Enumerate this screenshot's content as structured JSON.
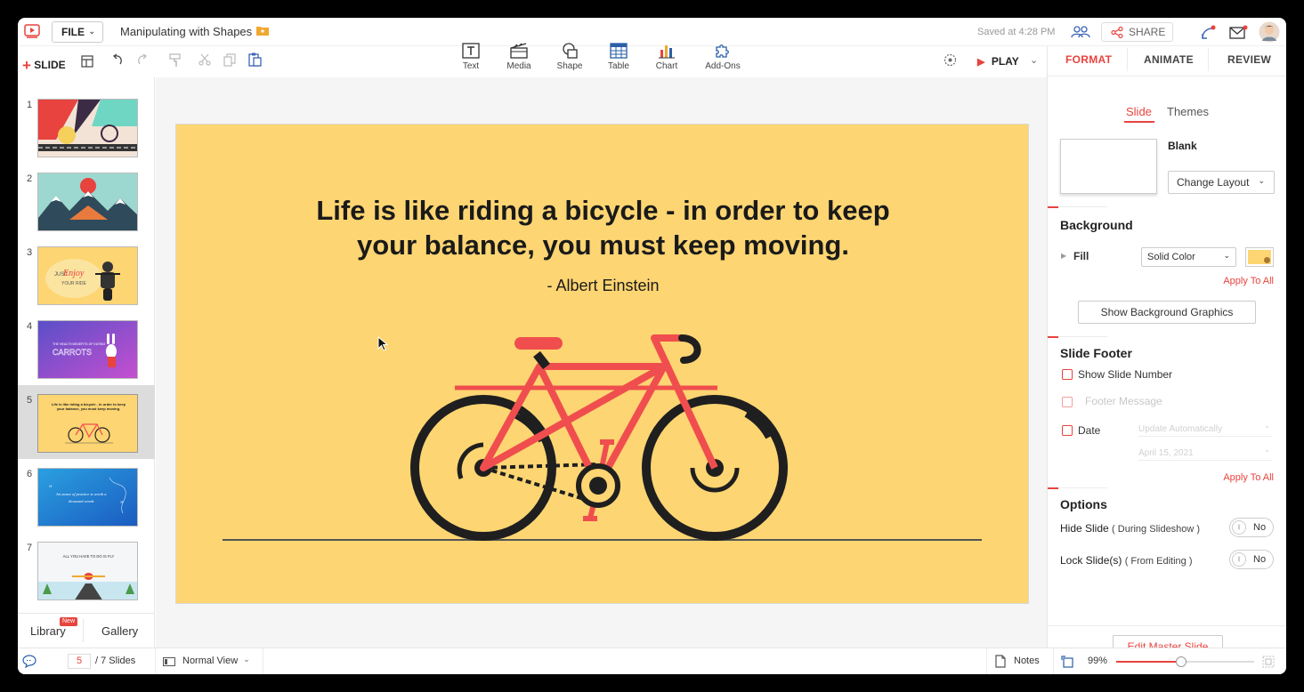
{
  "header": {
    "file_label": "FILE",
    "doc_title": "Manipulating with Shapes",
    "saved_status": "Saved at 4:28 PM",
    "share_label": "SHARE"
  },
  "toolbar": {
    "slide_label": "SLIDE",
    "insert_tools": [
      {
        "label": "Text",
        "icon": "text-box-icon"
      },
      {
        "label": "Media",
        "icon": "media-clapper-icon"
      },
      {
        "label": "Shape",
        "icon": "shape-icon"
      },
      {
        "label": "Table",
        "icon": "table-icon"
      },
      {
        "label": "Chart",
        "icon": "chart-icon"
      },
      {
        "label": "Add-Ons",
        "icon": "puzzle-icon"
      }
    ],
    "play_label": "PLAY"
  },
  "right_tabs": [
    "FORMAT",
    "ANIMATE",
    "REVIEW"
  ],
  "sub_tabs": [
    "Slide",
    "Themes"
  ],
  "slides": [
    {
      "number": "1"
    },
    {
      "number": "2"
    },
    {
      "number": "3",
      "text": "JUST Enjoy YOUR RIDE"
    },
    {
      "number": "4",
      "text": "THE HEALTH BENEFITS OF EATING CARROTS"
    },
    {
      "number": "5",
      "text": "Life is like riding a bicycle - in order to keep your balance, you must keep moving."
    },
    {
      "number": "6",
      "text": "An ounce of practice is worth a thousand words"
    },
    {
      "number": "7",
      "text": "ALL YOU HAVE TO DO IS FLY"
    }
  ],
  "left_bottom": {
    "library": "Library",
    "library_badge": "New",
    "gallery": "Gallery"
  },
  "slide_content": {
    "quote": "Life is like riding a bicycle - in order to keep your balance, you must keep moving.",
    "author": "- Albert Einstein"
  },
  "format_panel": {
    "layout_name": "Blank",
    "change_layout": "Change Layout",
    "background_title": "Background",
    "fill_label": "Fill",
    "fill_type": "Solid Color",
    "fill_color": "#fdd572",
    "apply_to_all": "Apply To All",
    "show_bg_graphics": "Show Background Graphics",
    "footer_title": "Slide Footer",
    "show_slide_number": "Show Slide Number",
    "footer_message": "Footer Message",
    "date_label": "Date",
    "date_mode": "Update Automatically",
    "date_value": "April 15, 2021",
    "options_title": "Options",
    "hide_slide": "Hide Slide",
    "hide_slide_note": "( During Slideshow )",
    "lock_slide": "Lock Slide(s)",
    "lock_slide_note": "( From Editing )",
    "toggle_no": "No",
    "edit_master": "Edit Master Slide"
  },
  "status": {
    "current_slide": "5",
    "total_slides": "/ 7 Slides",
    "view_mode": "Normal View",
    "notes_label": "Notes",
    "zoom": "99%",
    "zoom_fraction": 0.47
  },
  "colors": {
    "accent": "#e8433e",
    "slide_bg": "#fdd572",
    "bike_red": "#f04e4e"
  }
}
